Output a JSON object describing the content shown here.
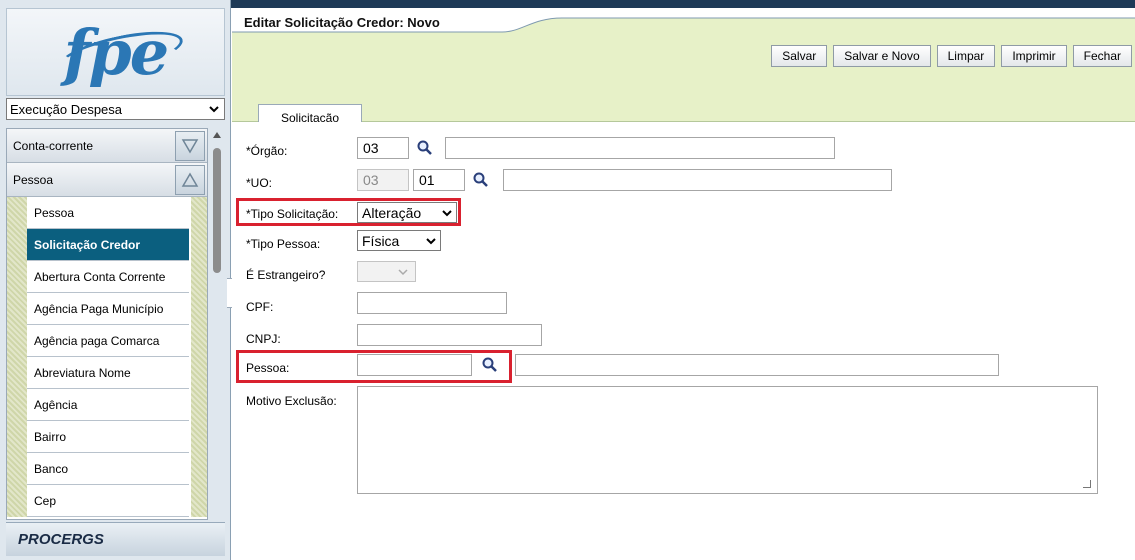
{
  "app": {
    "logo": "fpe",
    "footer_logo": "PROCERGS"
  },
  "module_select": {
    "value": "Execução Despesa"
  },
  "nav": {
    "groups": [
      {
        "label": "Conta-corrente"
      },
      {
        "label": "Pessoa"
      }
    ],
    "items": [
      {
        "label": "Pessoa"
      },
      {
        "label": "Solicitação Credor"
      },
      {
        "label": "Abertura Conta Corrente"
      },
      {
        "label": "Agência Paga Município"
      },
      {
        "label": "Agência paga Comarca"
      },
      {
        "label": "Abreviatura Nome"
      },
      {
        "label": "Agência"
      },
      {
        "label": "Bairro"
      },
      {
        "label": "Banco"
      },
      {
        "label": "Cep"
      }
    ]
  },
  "header": {
    "title": "Editar Solicitação Credor: Novo",
    "buttons": {
      "save": "Salvar",
      "save_new": "Salvar e Novo",
      "clear": "Limpar",
      "print": "Imprimir",
      "close": "Fechar"
    },
    "tab": "Solicitação"
  },
  "form": {
    "orgao": {
      "label": "*Órgão:",
      "code": "03",
      "desc": ""
    },
    "uo": {
      "label": "*UO:",
      "code1": "03",
      "code2": "01",
      "desc": ""
    },
    "tipo_solicitacao": {
      "label": "*Tipo Solicitação:",
      "value": "Alteração"
    },
    "tipo_pessoa": {
      "label": "*Tipo Pessoa:",
      "value": "Física"
    },
    "estrangeiro": {
      "label": "É Estrangeiro?",
      "value": ""
    },
    "cpf": {
      "label": "CPF:",
      "value": ""
    },
    "cnpj": {
      "label": "CNPJ:",
      "value": ""
    },
    "pessoa": {
      "label": "Pessoa:",
      "code": "",
      "desc": ""
    },
    "motivo": {
      "label": "Motivo Exclusão:",
      "value": ""
    }
  },
  "colors": {
    "highlight": "#d9212f",
    "active_nav": "#0b5f7f",
    "header_bg": "#e7f1c8"
  }
}
